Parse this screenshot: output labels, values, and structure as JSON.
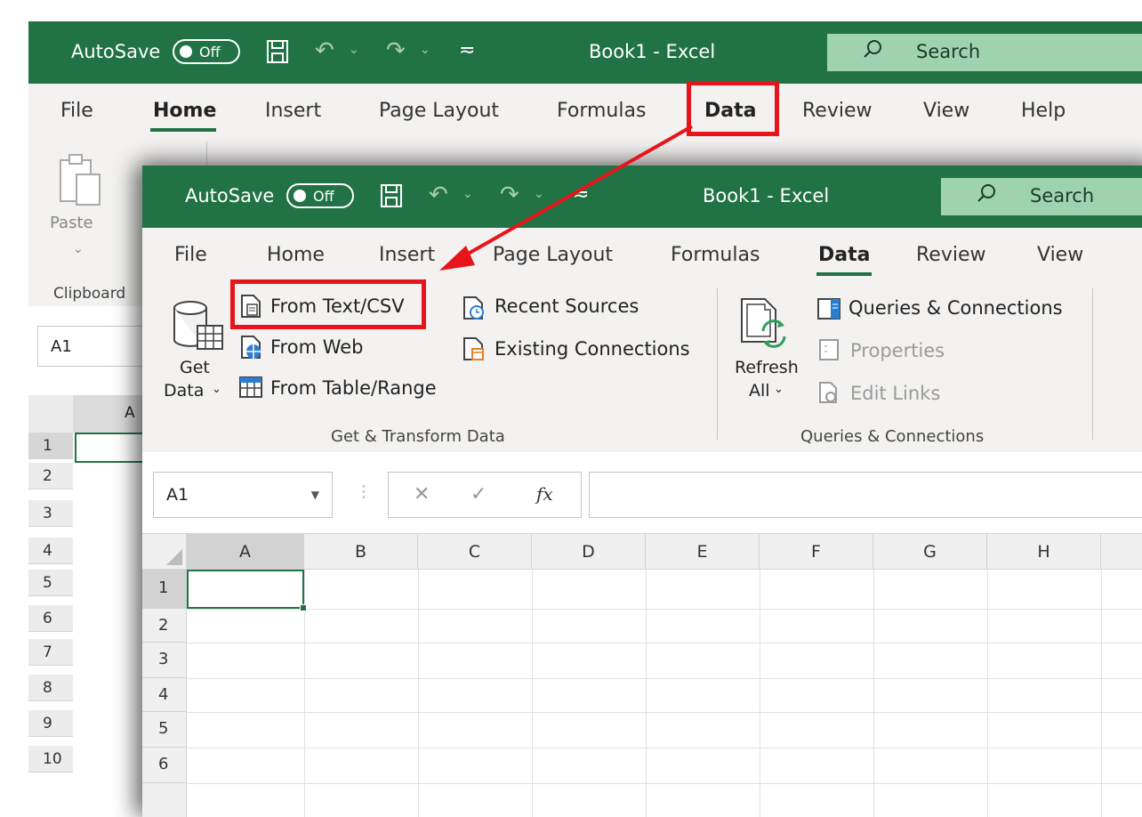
{
  "window_title": "Book1  -  Excel",
  "autosave_label": "AutoSave",
  "autosave_state": "Off",
  "search_label": "Search",
  "accent_color": "#217346",
  "highlight_color": "#e8141b",
  "back": {
    "tabs": [
      "File",
      "Home",
      "Insert",
      "Page Layout",
      "Formulas",
      "Data",
      "Review",
      "View",
      "Help"
    ],
    "active_tab": "Home",
    "paste_label": "Paste",
    "clipboard_group": "Clipboard",
    "name_box": "A1",
    "col_header": "A",
    "rows": [
      "1",
      "2",
      "3",
      "4",
      "5",
      "6",
      "7",
      "8",
      "9",
      "10"
    ]
  },
  "front": {
    "tabs": [
      "File",
      "Home",
      "Insert",
      "Page Layout",
      "Formulas",
      "Data",
      "Review",
      "View"
    ],
    "active_tab": "Data",
    "get_data_label_1": "Get",
    "get_data_label_2": "Data",
    "from_text_csv": "From Text/CSV",
    "from_web": "From Web",
    "from_table_range": "From Table/Range",
    "recent_sources": "Recent Sources",
    "existing_connections": "Existing Connections",
    "get_transform_group": "Get & Transform Data",
    "refresh_label_1": "Refresh",
    "refresh_label_2": "All",
    "queries_connections_btn": "Queries & Connections",
    "properties": "Properties",
    "edit_links": "Edit Links",
    "queries_group": "Queries & Connections",
    "name_box": "A1",
    "fx_label": "fx",
    "columns": [
      "A",
      "B",
      "C",
      "D",
      "E",
      "F",
      "G",
      "H"
    ],
    "rows": [
      "1",
      "2",
      "3",
      "4",
      "5",
      "6"
    ]
  }
}
